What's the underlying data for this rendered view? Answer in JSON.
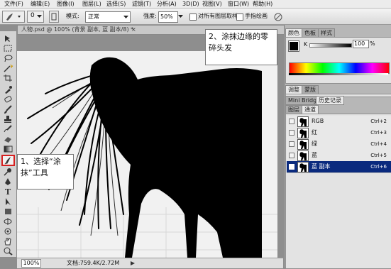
{
  "menu": {
    "items": [
      "文件(F)",
      "编辑(E)",
      "图像(I)",
      "图层(L)",
      "选择(S)",
      "滤镜(T)",
      "分析(A)",
      "3D(D)",
      "视图(V)",
      "窗口(W)",
      "帮助(H)"
    ]
  },
  "options": {
    "size_value": "0",
    "mode_label": "模式:",
    "mode_value": "正常",
    "strength_label": "强度:",
    "strength_value": "50%",
    "sample_all_label": "对所有图层取样",
    "finger_paint_label": "手指绘画"
  },
  "document": {
    "title": "人物.psd @ 100% (背景 副本, 蓝 副本/8) *"
  },
  "status": {
    "zoom": "100%",
    "doc_info": "文档:759.4K/2.72M"
  },
  "callouts": {
    "step1": [
      "1、选择“涂",
      "抹”工具"
    ],
    "step2": [
      "2、涂抹边缘的零",
      "碎头发"
    ]
  },
  "color_panel": {
    "tabs": [
      "颜色",
      "色板",
      "样式"
    ],
    "k_label": "K",
    "k_value": "100",
    "k_unit": "%"
  },
  "adjust_panel": {
    "tabs": [
      "调整",
      "蒙版"
    ]
  },
  "history_panel": {
    "tabs": [
      "Mini Bridge",
      "历史记录"
    ]
  },
  "layers_panel": {
    "tabs": [
      "图层",
      "通道"
    ],
    "channels": [
      {
        "name": "RGB",
        "shortcut": "Ctrl+2",
        "selected": false
      },
      {
        "name": "红",
        "shortcut": "Ctrl+3",
        "selected": false
      },
      {
        "name": "绿",
        "shortcut": "Ctrl+4",
        "selected": false
      },
      {
        "name": "蓝",
        "shortcut": "Ctrl+5",
        "selected": false
      },
      {
        "name": "蓝 副本",
        "shortcut": "Ctrl+6",
        "selected": true
      }
    ]
  },
  "colors": {
    "highlight": "#d62020",
    "selection": "#0a2a7e"
  },
  "icons": [
    "move-icon",
    "marquee-icon",
    "lasso-icon",
    "magic-wand-icon",
    "crop-icon",
    "eyedropper-icon",
    "healing-icon",
    "brush-icon",
    "clone-stamp-icon",
    "history-brush-icon",
    "eraser-icon",
    "gradient-icon",
    "smudge-icon",
    "dodge-icon",
    "pen-icon",
    "type-icon",
    "path-select-icon",
    "shape-icon",
    "3d-rotate-icon",
    "3d-orbit-icon",
    "hand-icon",
    "zoom-icon"
  ]
}
